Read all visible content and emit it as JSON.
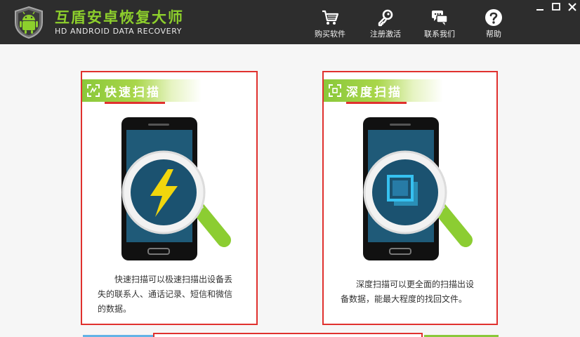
{
  "app": {
    "title": "互盾安卓恢复大师",
    "subtitle": "HD ANDROID DATA RECOVERY"
  },
  "nav": {
    "buy": "购买软件",
    "register": "注册激活",
    "contact": "联系我们",
    "help": "帮助"
  },
  "window": {
    "minimize": "–",
    "maximize": "□",
    "close": "✕"
  },
  "cards": {
    "quick": {
      "title": "快速扫描",
      "desc_line1": "快速扫描可以极速扫描出设备丢",
      "desc_line2": "失的联系人、通话记录、短信和微信",
      "desc_line3": "的数据。"
    },
    "deep": {
      "title": "深度扫描",
      "desc_line1": "深度扫描可以更全面的扫描出设",
      "desc_line2": "备数据，能最大程度的找回文件。"
    }
  },
  "colors": {
    "titlebar": "#2d2d2d",
    "brand_green": "#8dcf2c",
    "card_border": "#e0312e",
    "phone_screen": "#1f5a78",
    "bolt": "#f1d60d",
    "layers": "#36c1f0"
  },
  "icons": {
    "logo": "android-shield-logo",
    "buy": "shopping-cart-icon",
    "register": "key-icon",
    "contact": "chat-bubbles-icon",
    "help": "question-circle-icon"
  }
}
